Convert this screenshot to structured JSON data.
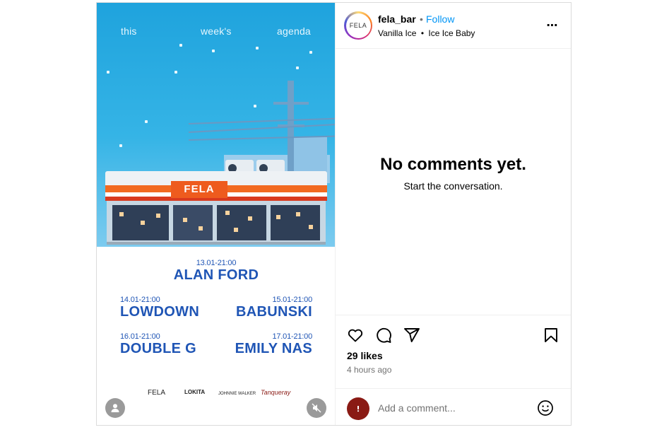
{
  "post": {
    "username": "fela_bar",
    "avatar_text": "FELA",
    "separator": "•",
    "follow_label": "Follow",
    "audio": {
      "artist": "Vanilla Ice",
      "separator": "•",
      "title": "Ice Ice Baby"
    },
    "more_icon": "more-horizontal-icon",
    "more_label": "⋯"
  },
  "media": {
    "header_words": [
      "this",
      "week's",
      "agenda"
    ],
    "store_sign": "FELA",
    "events": [
      {
        "when": "13.01-21:00",
        "who": "ALAN FORD"
      },
      {
        "when": "14.01-21:00",
        "who": "LOWDOWN"
      },
      {
        "when": "15.01-21:00",
        "who": "BABUNSKI"
      },
      {
        "when": "16.01-21:00",
        "who": "DOUBLE G"
      },
      {
        "when": "17.01-21:00",
        "who": "EMILY NAS"
      }
    ],
    "sponsors": [
      "FELA",
      "LOKITA",
      "JOHNNIE WALKER",
      "Tanqueray"
    ],
    "colors": {
      "sky": "#35b4e6",
      "event_text": "#1f55b5",
      "brand_orange": "#f26a21"
    }
  },
  "comments": {
    "empty_title": "No comments yet.",
    "empty_subtitle": "Start the conversation."
  },
  "engagement": {
    "likes_text": "29 likes",
    "time_ago": "4 hours ago"
  },
  "composer": {
    "placeholder": "Add a comment...",
    "emoji_icon": "emoji-icon"
  },
  "colors": {
    "link": "#0095f6",
    "muted": "#737373",
    "border": "#dbdbdb"
  }
}
